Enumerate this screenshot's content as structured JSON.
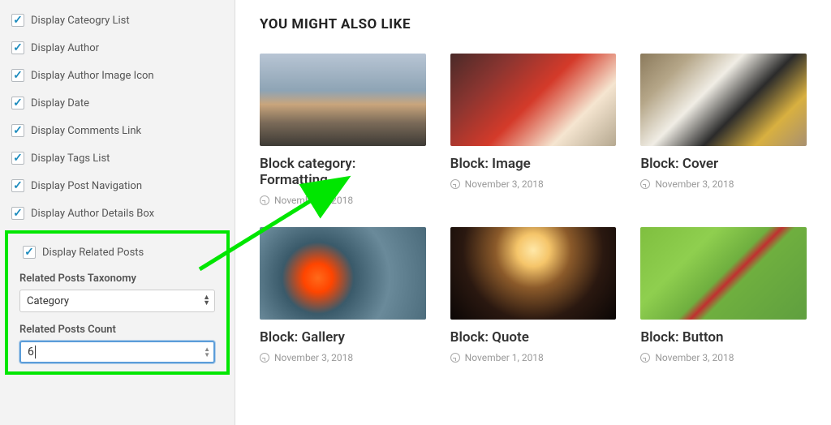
{
  "sidebar": {
    "checkboxes": [
      {
        "label": "Display Cateogry List",
        "checked": true
      },
      {
        "label": "Display Author",
        "checked": true
      },
      {
        "label": "Display Author Image Icon",
        "checked": true
      },
      {
        "label": "Display Date",
        "checked": true
      },
      {
        "label": "Display Comments Link",
        "checked": true
      },
      {
        "label": "Display Tags List",
        "checked": true
      },
      {
        "label": "Display Post Navigation",
        "checked": true
      },
      {
        "label": "Display Author Details Box",
        "checked": true
      }
    ],
    "highlighted": {
      "related_posts_checkbox": {
        "label": "Display Related Posts",
        "checked": true
      },
      "taxonomy_label": "Related Posts Taxonomy",
      "taxonomy_value": "Category",
      "count_label": "Related Posts Count",
      "count_value": "6"
    }
  },
  "preview": {
    "section_title": "YOU MIGHT ALSO LIKE",
    "cards": [
      {
        "title": "Block category: Formatting",
        "date": "November 1, 2018"
      },
      {
        "title": "Block: Image",
        "date": "November 3, 2018"
      },
      {
        "title": "Block: Cover",
        "date": "November 3, 2018"
      },
      {
        "title": "Block: Gallery",
        "date": "November 3, 2018"
      },
      {
        "title": "Block: Quote",
        "date": "November 1, 2018"
      },
      {
        "title": "Block: Button",
        "date": "November 3, 2018"
      }
    ]
  }
}
